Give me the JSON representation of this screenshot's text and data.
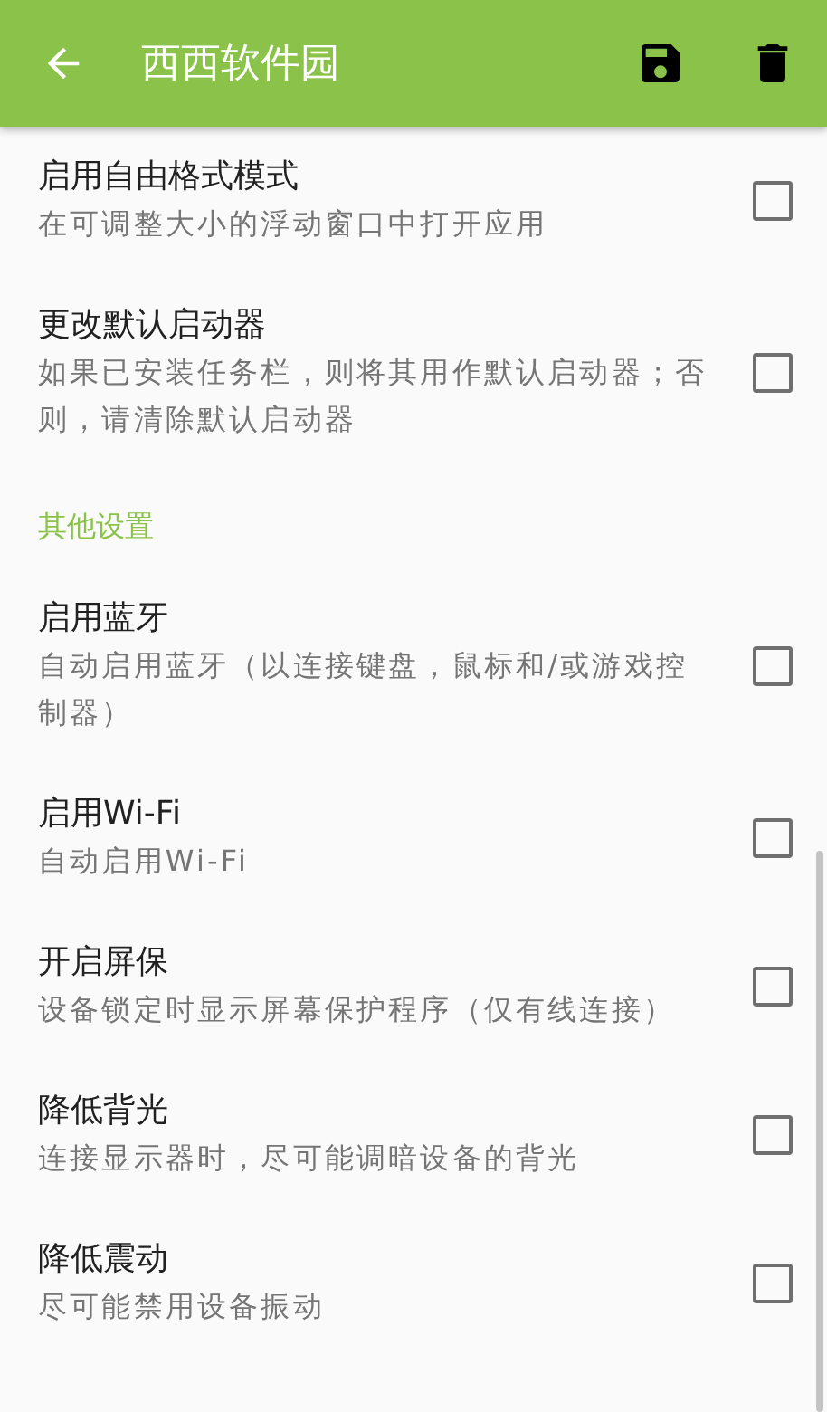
{
  "app_bar": {
    "title": "西西软件园"
  },
  "items": [
    {
      "kind": "pref",
      "title": "启用自由格式模式",
      "subtitle": "在可调整大小的浮动窗口中打开应用",
      "checked": false
    },
    {
      "kind": "pref",
      "title": "更改默认启动器",
      "subtitle": "如果已安装任务栏，则将其用作默认启动器；否则，请清除默认启动器",
      "checked": false
    },
    {
      "kind": "header",
      "title": "其他设置"
    },
    {
      "kind": "pref",
      "title": "启用蓝牙",
      "subtitle": "自动启用蓝牙（以连接键盘，鼠标和/或游戏控制器）",
      "checked": false
    },
    {
      "kind": "pref",
      "title": "启用Wi-Fi",
      "subtitle": "自动启用Wi-Fi",
      "checked": false
    },
    {
      "kind": "pref",
      "title": "开启屏保",
      "subtitle": "设备锁定时显示屏幕保护程序（仅有线连接）",
      "checked": false
    },
    {
      "kind": "pref",
      "title": "降低背光",
      "subtitle": "连接显示器时，尽可能调暗设备的背光",
      "checked": false
    },
    {
      "kind": "pref",
      "title": "降低震动",
      "subtitle": "尽可能禁用设备振动",
      "checked": false
    }
  ]
}
